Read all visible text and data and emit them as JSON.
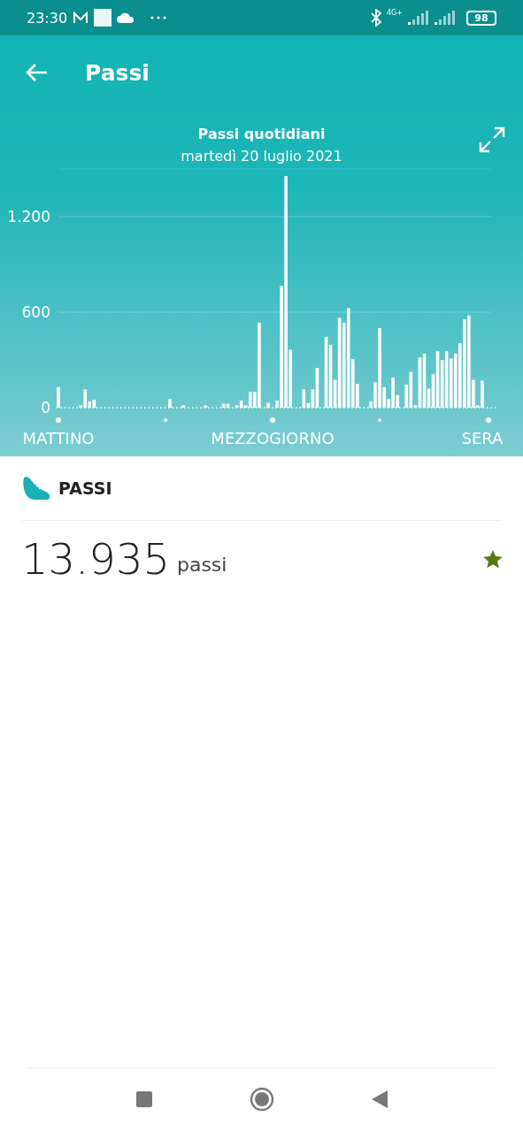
{
  "status_bar": {
    "time": "23:30",
    "network": "4G+",
    "battery": "98"
  },
  "header": {
    "title": "Passi"
  },
  "chart": {
    "title": "Passi quotidiani",
    "date": "martedì 20 luglio 2021",
    "chart_data": {
      "type": "bar",
      "categories": [
        "MATTINO",
        null,
        null,
        null,
        null,
        null,
        null,
        null,
        null,
        null,
        null,
        null,
        null,
        null,
        null,
        null,
        null,
        null,
        null,
        null,
        null,
        null,
        null,
        null,
        null,
        null,
        null,
        null,
        null,
        null,
        null,
        null,
        null,
        null,
        null,
        null,
        null,
        null,
        null,
        null,
        null,
        null,
        null,
        null,
        null,
        null,
        null,
        null,
        "MEZZOGIORNO",
        null,
        null,
        null,
        null,
        null,
        null,
        null,
        null,
        null,
        null,
        null,
        null,
        null,
        null,
        null,
        null,
        null,
        null,
        null,
        null,
        null,
        null,
        null,
        null,
        null,
        null,
        null,
        null,
        null,
        null,
        null,
        null,
        null,
        null,
        null,
        null,
        null,
        null,
        null,
        null,
        null,
        null,
        null,
        null,
        null,
        null,
        "SERA"
      ],
      "ylim": [
        0,
        1500
      ],
      "yticks": [
        {
          "value": 0,
          "label": "0"
        },
        {
          "value": 600,
          "label": "600"
        },
        {
          "value": 1200,
          "label": "1.200"
        }
      ],
      "values": [
        130,
        null,
        null,
        null,
        null,
        15,
        115,
        40,
        50,
        null,
        null,
        null,
        null,
        null,
        null,
        null,
        null,
        null,
        null,
        null,
        null,
        null,
        null,
        null,
        null,
        55,
        null,
        null,
        15,
        null,
        null,
        null,
        null,
        15,
        null,
        null,
        null,
        25,
        25,
        null,
        15,
        45,
        15,
        100,
        100,
        535,
        null,
        30,
        null,
        45,
        765,
        1455,
        365,
        null,
        null,
        115,
        30,
        115,
        250,
        null,
        445,
        395,
        175,
        565,
        535,
        625,
        305,
        150,
        null,
        null,
        40,
        160,
        500,
        130,
        55,
        190,
        80,
        null,
        145,
        225,
        15,
        315,
        340,
        120,
        210,
        355,
        300,
        355,
        310,
        340,
        405,
        555,
        580,
        175,
        15,
        170
      ]
    }
  },
  "summary": {
    "heading": "PASSI",
    "value": "13.935",
    "unit": "passi",
    "goal_reached": true
  }
}
